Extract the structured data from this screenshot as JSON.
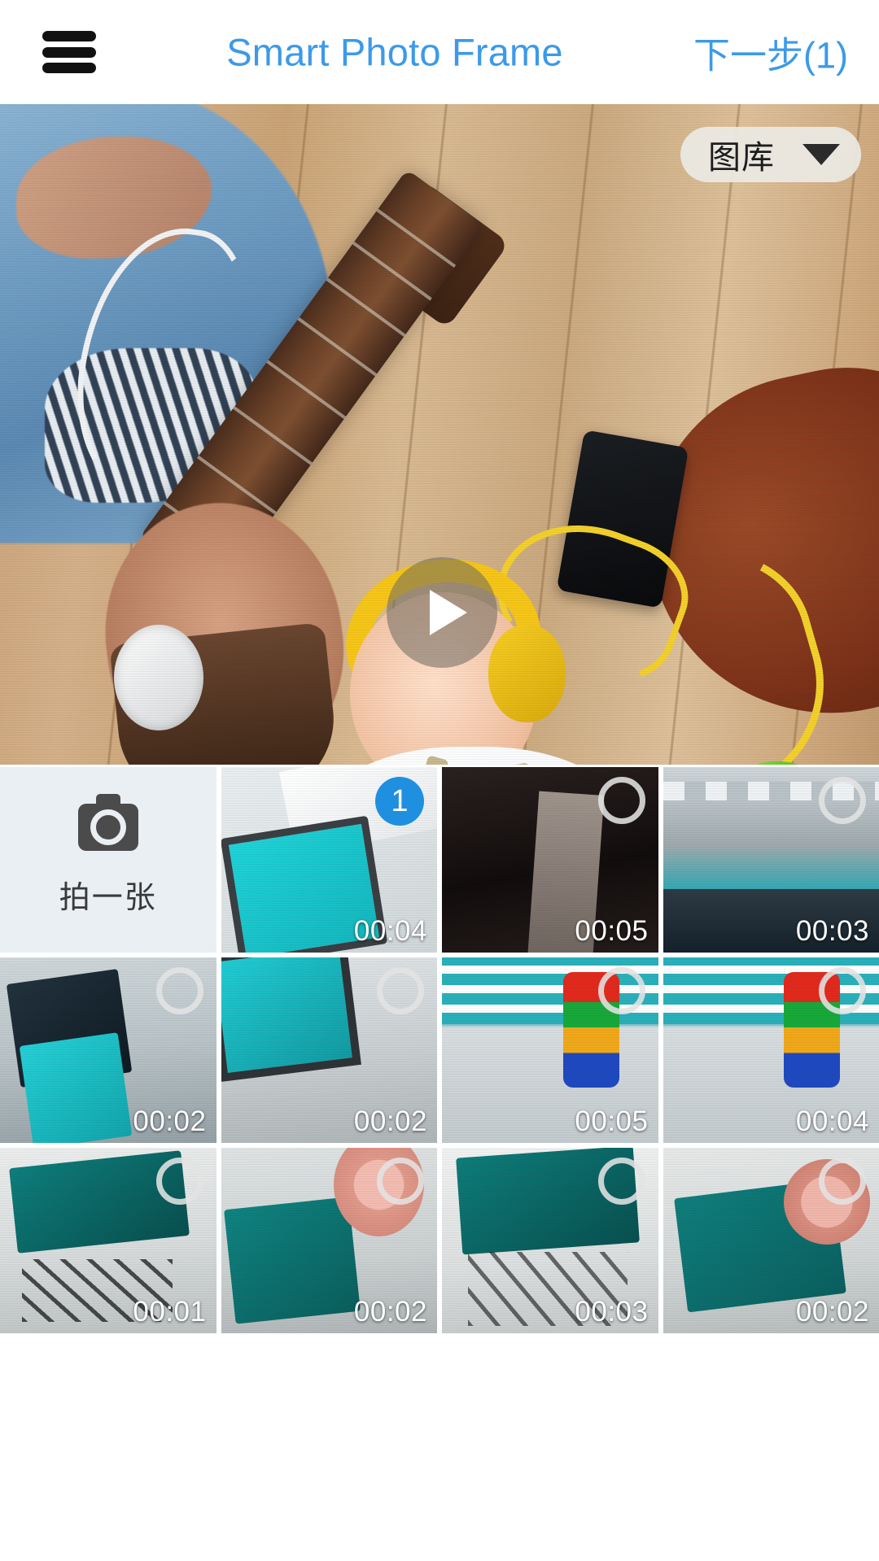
{
  "header": {
    "menu_icon": "hamburger-menu-icon",
    "title": "Smart Photo Frame",
    "next_label": "下一步(1)"
  },
  "preview": {
    "source_dropdown": {
      "label": "图库",
      "caret_icon": "chevron-down-icon"
    },
    "play_button": {
      "icon": "play-icon"
    }
  },
  "grid": {
    "camera_tile": {
      "icon": "camera-icon",
      "label": "拍一张"
    },
    "items": [
      {
        "duration": "00:04",
        "selected": true,
        "badge": "1",
        "scene": "sc-desk-teal"
      },
      {
        "duration": "00:05",
        "selected": false,
        "badge": "",
        "scene": "sc-dark"
      },
      {
        "duration": "00:03",
        "selected": false,
        "badge": "",
        "scene": "sc-ceiling"
      },
      {
        "duration": "00:02",
        "selected": false,
        "badge": "",
        "scene": "sc-office"
      },
      {
        "duration": "00:02",
        "selected": false,
        "badge": "",
        "scene": "sc-floor"
      },
      {
        "duration": "00:05",
        "selected": false,
        "badge": "",
        "scene": "sc-tower"
      },
      {
        "duration": "00:04",
        "selected": false,
        "badge": "",
        "scene": "sc-tower"
      },
      {
        "duration": "00:01",
        "selected": false,
        "badge": "",
        "scene": "sc-wire"
      },
      {
        "duration": "00:02",
        "selected": false,
        "badge": "",
        "scene": "sc-fan"
      },
      {
        "duration": "00:03",
        "selected": false,
        "badge": "",
        "scene": "sc-desktop"
      },
      {
        "duration": "00:02",
        "selected": false,
        "badge": "",
        "scene": "sc-board"
      }
    ]
  },
  "colors": {
    "accent": "#3c9ae8",
    "badge": "#1f8fe0",
    "camera_tile_bg": "#eaeff4",
    "dropdown_bg": "#ebe9e4",
    "duration_text": "#ffffff"
  }
}
